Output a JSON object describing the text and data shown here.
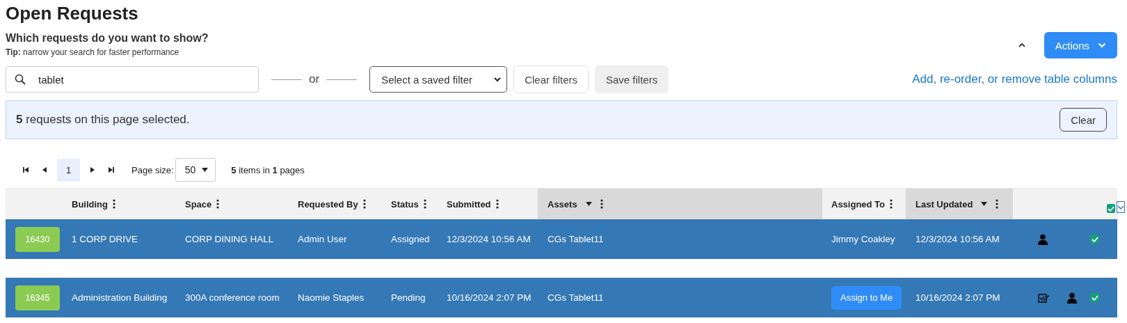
{
  "title": "Open Requests",
  "filter_panel": {
    "heading": "Which requests do you want to show?",
    "tip": "**Tip:** narrow your search for faster performance",
    "expanded": true,
    "search": {
      "value": "tablet"
    },
    "separator": "or",
    "saved_filter": {
      "value": "Select a saved filter"
    },
    "buttons": [
      {
        "label": "Clear filters",
        "kind": "outline"
      },
      {
        "label": "Save filters",
        "kind": "filled"
      }
    ],
    "columns_link": "Add, re-order, or remove table columns"
  },
  "actions_button": "Actions",
  "selection_banner": {
    "text": "**5** requests on this page selected.",
    "button": "Clear"
  },
  "pager": {
    "pages": [
      {
        "label": "1",
        "selected": true
      }
    ],
    "page_size_label": "Page size:",
    "page_size": "50",
    "summary": "**5** items in **1** pages"
  },
  "table": {
    "columns": [
      {
        "label": "Building",
        "sorted": false
      },
      {
        "label": "Space",
        "sorted": false
      },
      {
        "label": "Requested By",
        "sorted": false
      },
      {
        "label": "Status",
        "sorted": false
      },
      {
        "label": "Submitted",
        "sorted": false
      },
      {
        "label": "Assets",
        "sorted": true
      },
      {
        "label": "Assigned To",
        "sorted": false
      },
      {
        "label": "Last Updated",
        "sorted": true
      }
    ],
    "all_checked": true,
    "rows": [
      {
        "id": "16430",
        "building": "1 CORP DRIVE",
        "space": "CORP DINING HALL",
        "requested_by": "Admin User",
        "status": "Assigned",
        "submitted": "12/3/2024 10:56 AM",
        "assets": "CGs Tablet11",
        "assigned_to": {
          "kind": "text",
          "label": "Jimmy Coakley"
        },
        "last_updated": "12/3/2024 10:56 AM",
        "editable": false,
        "selected": true,
        "checked": true
      },
      {
        "id": "16345",
        "building": "Administration Building",
        "space": "300A conference room",
        "requested_by": "Naomie Staples",
        "status": "Pending",
        "submitted": "10/16/2024 2:07 PM",
        "assets": "CGs Tablet11",
        "assigned_to": {
          "kind": "button",
          "label": "Assign to Me"
        },
        "last_updated": "10/16/2024 2:07 PM",
        "editable": true,
        "selected": true,
        "checked": true
      }
    ]
  }
}
